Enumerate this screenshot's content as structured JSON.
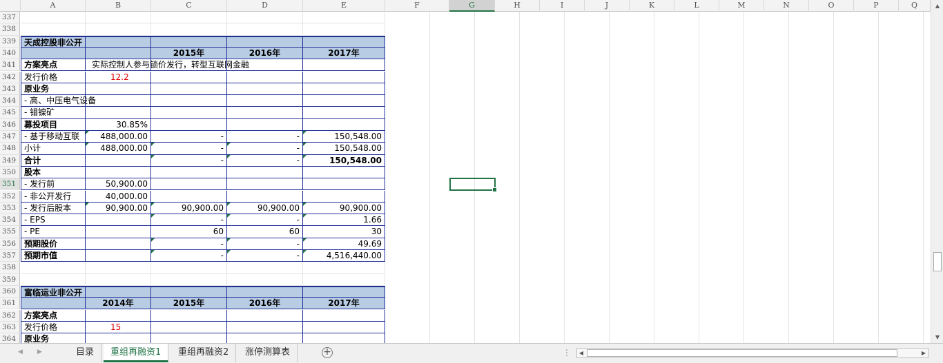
{
  "columns": [
    "A",
    "B",
    "C",
    "D",
    "E",
    "F",
    "G",
    "H",
    "I",
    "J",
    "K",
    "L",
    "M",
    "N",
    "O",
    "P",
    "Q"
  ],
  "selected_column": "G",
  "selected_row": "351",
  "rows": [
    {
      "n": "337",
      "cells": [
        "",
        "",
        "",
        "",
        ""
      ]
    },
    {
      "n": "338",
      "cells": [
        "",
        "",
        "",
        "",
        ""
      ]
    },
    {
      "n": "339",
      "cells": [
        "天成控股非公开",
        "",
        "",
        "",
        ""
      ]
    },
    {
      "n": "340",
      "cells": [
        "",
        "",
        "2015年",
        "2016年",
        "2017年"
      ]
    },
    {
      "n": "341",
      "cells": [
        "方案亮点",
        "实际控制人参与锁价发行，转型互联网金融",
        "",
        "",
        ""
      ]
    },
    {
      "n": "342",
      "cells": [
        "发行价格",
        "12.2",
        "",
        "",
        ""
      ]
    },
    {
      "n": "343",
      "cells": [
        "原业务",
        "",
        "",
        "",
        ""
      ]
    },
    {
      "n": "344",
      "cells": [
        " - 高、中压电气设备",
        "",
        "",
        "",
        ""
      ]
    },
    {
      "n": "345",
      "cells": [
        " - 钼镍矿",
        "",
        "",
        "",
        ""
      ]
    },
    {
      "n": "346",
      "cells": [
        "募投项目",
        "30.85%",
        "",
        "",
        ""
      ]
    },
    {
      "n": "347",
      "cells": [
        " - 基于移动互联",
        "488,000.00",
        "-",
        "-",
        "150,548.00"
      ]
    },
    {
      "n": "348",
      "cells": [
        "小计",
        "488,000.00",
        "-",
        "-",
        "150,548.00"
      ]
    },
    {
      "n": "349",
      "cells": [
        "合计",
        "",
        "-",
        "-",
        "150,548.00"
      ]
    },
    {
      "n": "350",
      "cells": [
        "股本",
        "",
        "",
        "",
        ""
      ]
    },
    {
      "n": "351",
      "cells": [
        " - 发行前",
        "50,900.00",
        "",
        "",
        ""
      ]
    },
    {
      "n": "352",
      "cells": [
        " - 非公开发行",
        "40,000.00",
        "",
        "",
        ""
      ]
    },
    {
      "n": "353",
      "cells": [
        " - 发行后股本",
        "90,900.00",
        "90,900.00",
        "90,900.00",
        "90,900.00"
      ]
    },
    {
      "n": "354",
      "cells": [
        " - EPS",
        "",
        "-",
        "-",
        "1.66"
      ]
    },
    {
      "n": "355",
      "cells": [
        " - PE",
        "",
        "60",
        "60",
        "30"
      ]
    },
    {
      "n": "356",
      "cells": [
        "预期股价",
        "",
        "-",
        "-",
        "49.69"
      ]
    },
    {
      "n": "357",
      "cells": [
        "预期市值",
        "",
        "-",
        "-",
        "4,516,440.00"
      ]
    },
    {
      "n": "358",
      "cells": [
        "",
        "",
        "",
        "",
        ""
      ]
    },
    {
      "n": "359",
      "cells": [
        "",
        "",
        "",
        "",
        ""
      ]
    },
    {
      "n": "360",
      "cells": [
        "富临运业非公开",
        "",
        "",
        "",
        ""
      ]
    },
    {
      "n": "361",
      "cells": [
        "",
        "2014年",
        "2015年",
        "2016年",
        "2017年"
      ]
    },
    {
      "n": "362",
      "cells": [
        "方案亮点",
        "",
        "",
        "",
        ""
      ]
    },
    {
      "n": "363",
      "cells": [
        "发行价格",
        "15",
        "",
        "",
        ""
      ]
    },
    {
      "n": "364",
      "cells": [
        "原业务",
        "",
        "",
        "",
        ""
      ]
    }
  ],
  "sheet_tabs": [
    "目录",
    "重组再融资1",
    "重组再融资2",
    "涨停测算表"
  ],
  "active_tab": "重组再融资1",
  "add_sheet": "+",
  "colors": {
    "accent": "#217346",
    "header_fill": "#b8cce4",
    "border": "#1f2f96",
    "red_text": "#e00000"
  }
}
